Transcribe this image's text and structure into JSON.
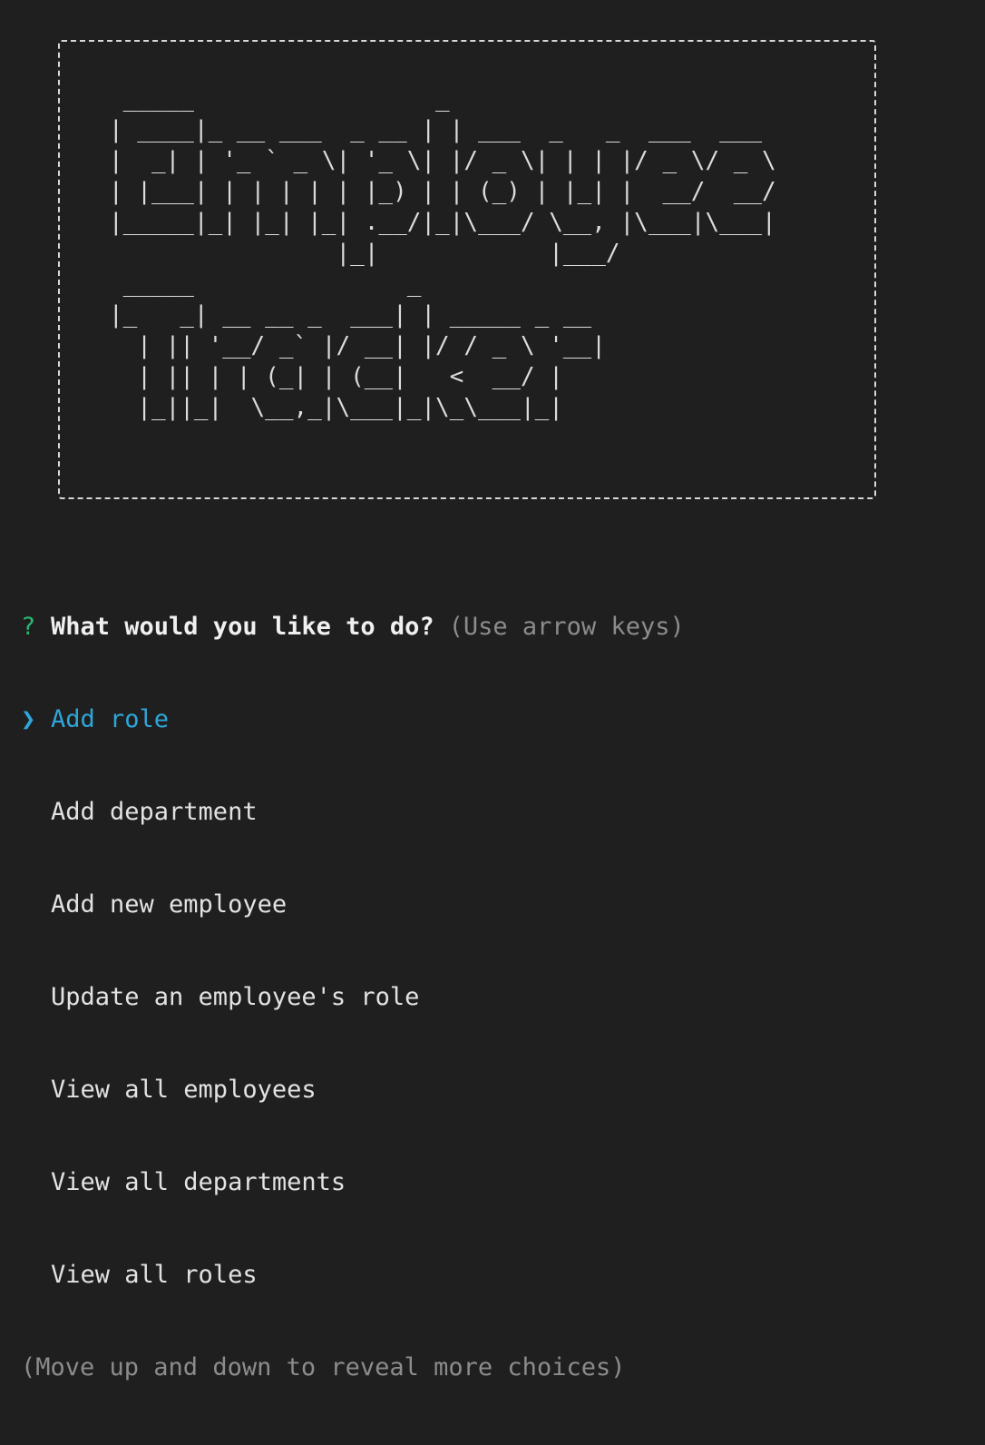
{
  "banner": {
    "art": " _____                 _\n| ____|_ __ ___  _ __ | | ___  _   _  ___  ___\n|  _| | '_ ` _ \\| '_ \\| |/ _ \\| | | |/ _ \\/ _ \\\n| |___| | | | | | |_) | | (_) | |_| |  __/  __/\n|_____|_| |_| |_| .__/|_|\\___/ \\__, |\\___|\\___|\n                |_|            |___/\n _____               _\n|_   _| __ __ _  ___| | _____ _ __\n  | || '__/ _` |/ __| |/ / _ \\ '__|\n  | || | | (_| | (__|   <  __/ |\n  |_||_|  \\__,_|\\___|_|\\_\\___|_|"
  },
  "prompt": {
    "question_mark": "?",
    "question": "What would you like to do?",
    "hint": "(Use arrow keys)",
    "pointer": "❯",
    "choices": [
      "Add role",
      "Add department",
      "Add new employee",
      "Update an employee's role",
      "View all employees",
      "View all departments",
      "View all roles"
    ],
    "footer": "(Move up and down to reveal more choices)"
  }
}
